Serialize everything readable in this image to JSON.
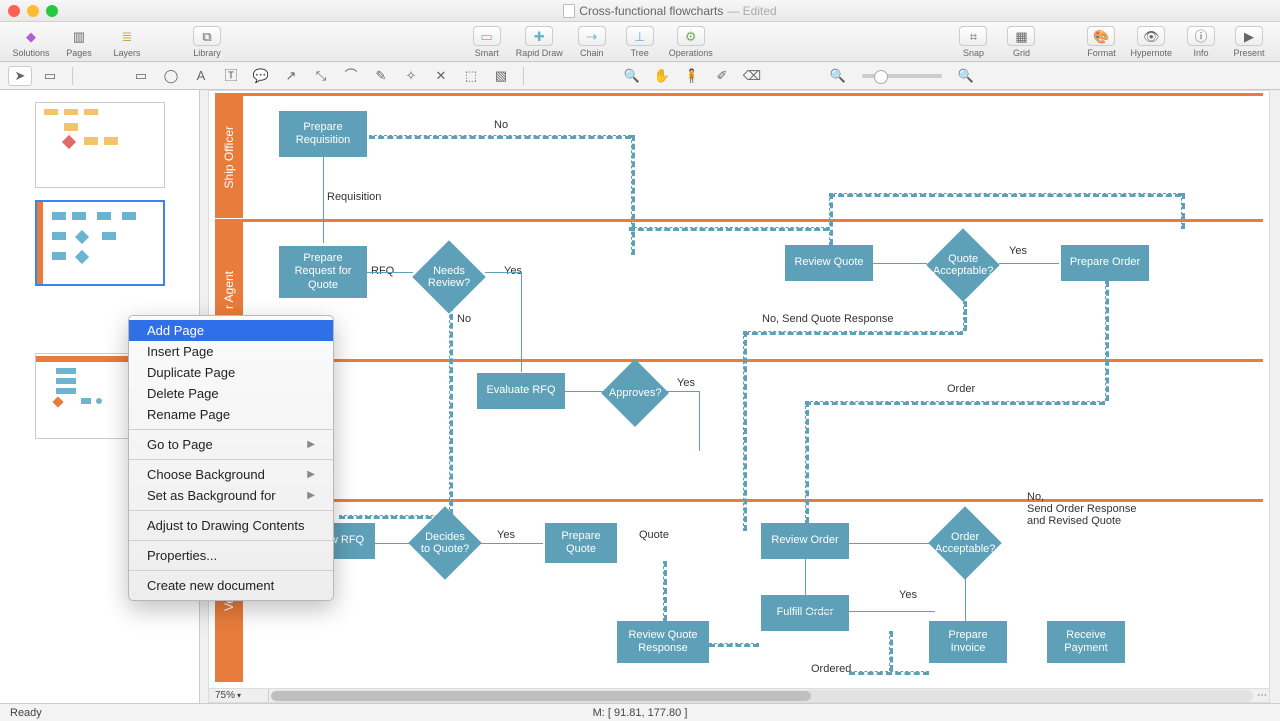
{
  "window": {
    "title": "Cross-functional flowcharts",
    "edited": "— Edited"
  },
  "toolbar": {
    "solutions": "Solutions",
    "pages": "Pages",
    "layers": "Layers",
    "library": "Library",
    "smart": "Smart",
    "rapid": "Rapid Draw",
    "chain": "Chain",
    "tree": "Tree",
    "ops": "Operations",
    "snap": "Snap",
    "grid": "Grid",
    "format": "Format",
    "hypernote": "Hypernote",
    "info": "Info",
    "present": "Present"
  },
  "ctx": {
    "add": "Add Page",
    "insert": "Insert Page",
    "dup": "Duplicate Page",
    "del": "Delete Page",
    "ren": "Rename Page",
    "goto": "Go to Page",
    "bg": "Choose Background",
    "setbg": "Set as Background for",
    "adjust": "Adjust to Drawing Contents",
    "props": "Properties...",
    "newdoc": "Create new document"
  },
  "lanes": {
    "ship": "Ship Officer",
    "agent": "r Agent",
    "vendor": "Vendor"
  },
  "shapes": {
    "prep_req": "Prepare\nRequisition",
    "prep_rfq": "Prepare\nRequest for\nQuote",
    "needs_review": "Needs\nReview?",
    "eval_rfq": "Evaluate RFQ",
    "approves": "Approves?",
    "review_quote": "Review Quote",
    "quote_acc": "Quote\nAcceptable?",
    "prepare_order": "Prepare Order",
    "w_rfq": "w RFQ",
    "decides": "Decides\nto Quote?",
    "prep_quote": "Prepare\nQuote",
    "review_order": "Review Order",
    "order_acc": "Order\nAcceptable?",
    "fulfill": "Fulfill Order",
    "rqr": "Review Quote\nResponse",
    "prep_inv": "Prepare\nInvoice",
    "recv_pay": "Receive\nPayment"
  },
  "labels": {
    "no1": "No",
    "requisition": "Requisition",
    "rfq": "RFQ",
    "yes1": "Yes",
    "no2": "No",
    "yes2": "Yes",
    "yes3": "Yes",
    "nosend": "No, Send Quote Response",
    "order": "Order",
    "yes4": "Yes",
    "quote": "Quote",
    "yes5": "Yes",
    "ordered": "Ordered",
    "nosend2": "No,\nSend Order Response\nand Revised Quote"
  },
  "footer": {
    "zoom": "75%"
  },
  "status": {
    "ready": "Ready",
    "mouse": "M: [ 91.81, 177.80 ]"
  }
}
